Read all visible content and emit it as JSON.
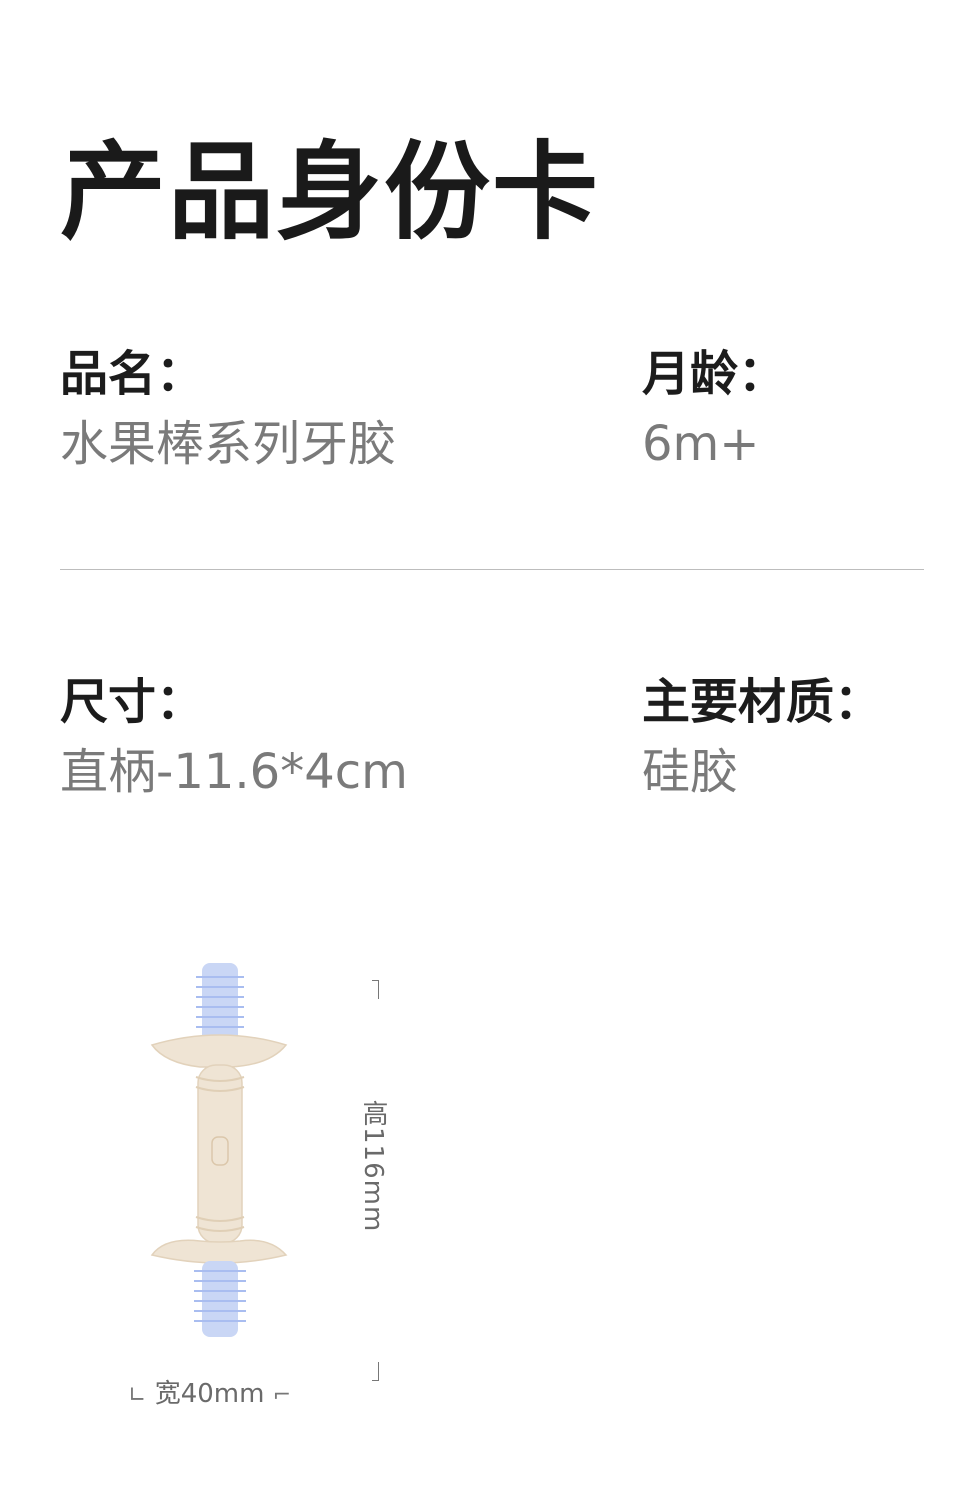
{
  "page": {
    "title": "产品身份卡"
  },
  "fields": {
    "name": {
      "label": "品名：",
      "value": "水果棒系列牙胶"
    },
    "age": {
      "label": "月龄：",
      "value": "6m+"
    },
    "size": {
      "label": "尺寸：",
      "value": "直柄-11.6*4cm"
    },
    "material": {
      "label": "主要材质：",
      "value": "硅胶"
    }
  },
  "dimensions": {
    "height_label": "高116mm",
    "width_label": "宽40mm"
  },
  "colors": {
    "bristle": "#c9d6f5",
    "handle": "#efe4d4"
  }
}
